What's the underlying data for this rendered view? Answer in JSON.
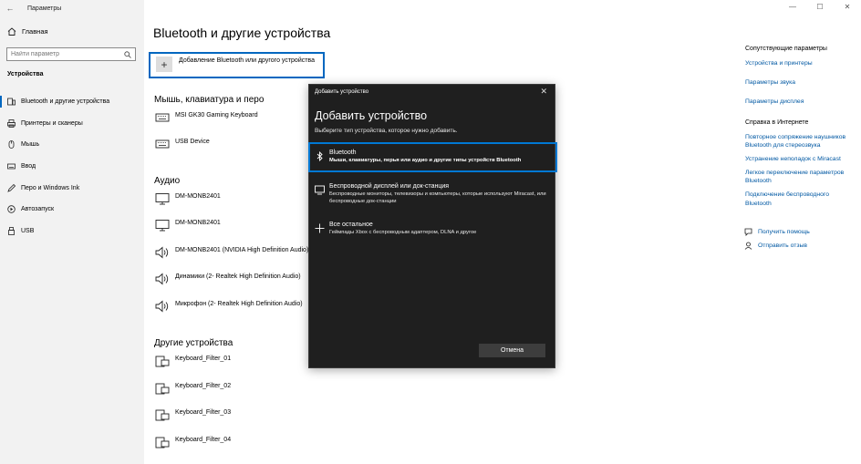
{
  "window": {
    "app_title": "Параметры",
    "back_glyph": "←",
    "minimize_glyph": "—",
    "maximize_glyph": "☐",
    "close_glyph": "✕"
  },
  "sidebar": {
    "home_label": "Главная",
    "search_placeholder": "Найти параметр",
    "section_label": "Устройства",
    "items": [
      {
        "label": "Bluetooth и другие устройства",
        "icon": "bluetooth-devices-icon",
        "active": true
      },
      {
        "label": "Принтеры и сканеры",
        "icon": "printer-icon",
        "active": false
      },
      {
        "label": "Мышь",
        "icon": "mouse-icon",
        "active": false
      },
      {
        "label": "Ввод",
        "icon": "keyboard-icon",
        "active": false
      },
      {
        "label": "Перо и Windows Ink",
        "icon": "pen-icon",
        "active": false
      },
      {
        "label": "Автозапуск",
        "icon": "autoplay-icon",
        "active": false
      },
      {
        "label": "USB",
        "icon": "usb-icon",
        "active": false
      }
    ]
  },
  "main": {
    "title": "Bluetooth и другие устройства",
    "add_label": "Добавление Bluetooth или другого устройства",
    "add_glyph": "+",
    "groups": {
      "input": {
        "title": "Мышь, клавиатура и перо",
        "devices": [
          "MSI GK30 Gaming Keyboard",
          "USB Device"
        ]
      },
      "audio": {
        "title": "Аудио",
        "devices": [
          "DM-MONB2401",
          "DM-MONB2401",
          "DM-MONB2401 (NVIDIA High Definition Audio)",
          "Динамики (2- Realtek High Definition Audio)",
          "Микрофон (2- Realtek High Definition Audio)"
        ]
      },
      "other": {
        "title": "Другие устройства",
        "devices": [
          "Keyboard_Filter_01",
          "Keyboard_Filter_02",
          "Keyboard_Filter_03",
          "Keyboard_Filter_04"
        ]
      }
    }
  },
  "right": {
    "related_title": "Сопутствующие параметры",
    "related_links": [
      "Устройства и принтеры",
      "Параметры звука",
      "Параметры дисплея"
    ],
    "help_title": "Справка в Интернете",
    "help_links": [
      "Повторное сопряжение наушников Bluetooth для стереозвука",
      "Устранение неполадок с Miracast",
      "Легкое переключение параметров Bluetooth",
      "Подключение беспроводного Bluetooth"
    ],
    "get_help": "Получить помощь",
    "feedback": "Отправить отзыв"
  },
  "dialog": {
    "bar_title": "Добавить устройство",
    "close_glyph": "✕",
    "title": "Добавить устройство",
    "subtitle": "Выберите тип устройства, которое нужно добавить.",
    "options": [
      {
        "title": "Bluetooth",
        "desc": "Мыши, клавиатуры, перья или аудио и другие типы устройств Bluetooth"
      },
      {
        "title": "Беспроводной дисплей или док-станция",
        "desc": "Беспроводные мониторы, телевизоры и компьютеры, которые используют Miracast, или беспроводные док-станции"
      },
      {
        "title": "Все остальное",
        "desc": "Геймпады Xbox с беспроводным адаптером, DLNA и другое"
      }
    ],
    "cancel_label": "Отмена"
  },
  "colors": {
    "accent": "#0067c0",
    "dialog_bg": "#1f1f1f",
    "link": "#0058a3"
  }
}
